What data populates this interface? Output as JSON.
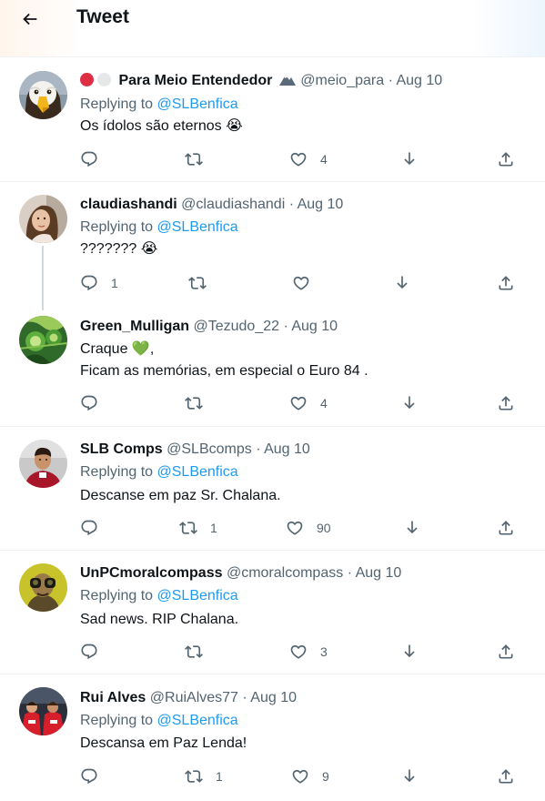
{
  "header": {
    "title": "Tweet",
    "back_icon": "arrow-left-icon"
  },
  "replying_label": "Replying to",
  "tweets": [
    {
      "name": "Para Meio Entendedor",
      "name_prefix_icons": [
        "red-circle-icon",
        "white-circle-icon"
      ],
      "name_suffix_icon": "mountain-icon",
      "handle": "@meio_para",
      "sep": "·",
      "date": "Aug 10",
      "replying_to": "@SLBenfica",
      "lines": [
        "Os ídolos são eternos 😭"
      ],
      "reply_count": "",
      "retweet_count": "",
      "like_count": "4",
      "avatar": "eagle-avatar"
    },
    {
      "name": "claudiashandi",
      "handle": "@claudiashandi",
      "sep": "·",
      "date": "Aug 10",
      "replying_to": "@SLBenfica",
      "lines": [
        "??????? 😭"
      ],
      "reply_count": "1",
      "retweet_count": "",
      "like_count": "",
      "avatar": "woman-photo-avatar"
    },
    {
      "name": "Green_Mulligan",
      "handle": "@Tezudo_22",
      "sep": "·",
      "date": "Aug 10",
      "replying_to": "",
      "lines": [
        "Craque 💚,",
        "Ficam as memórias, em especial o Euro 84 ."
      ],
      "reply_count": "",
      "retweet_count": "",
      "like_count": "4",
      "avatar": "green-pattern-avatar"
    },
    {
      "name": "SLB Comps",
      "handle": "@SLBcomps",
      "sep": "·",
      "date": "Aug 10",
      "replying_to": "@SLBenfica",
      "lines": [
        "Descanse em paz Sr. Chalana."
      ],
      "reply_count": "",
      "retweet_count": "1",
      "like_count": "90",
      "avatar": "player-photo-avatar"
    },
    {
      "name": "UnPCmoralcompass",
      "handle": "@cmoralcompass",
      "sep": "·",
      "date": "Aug 10",
      "replying_to": "@SLBenfica",
      "lines": [
        "Sad news. RIP Chalana."
      ],
      "reply_count": "",
      "retweet_count": "",
      "like_count": "3",
      "avatar": "binoculars-man-avatar"
    },
    {
      "name": "Rui Alves",
      "handle": "@RuiAlves77",
      "sep": "·",
      "date": "Aug 10",
      "replying_to": "@SLBenfica",
      "lines": [
        "Descansa em Paz Lenda!"
      ],
      "reply_count": "",
      "retweet_count": "1",
      "like_count": "9",
      "avatar": "football-team-avatar"
    }
  ],
  "colors": {
    "text": "#0f1419",
    "muted": "#536471",
    "link": "#1d9bf0",
    "divider": "#eff3f4",
    "thread_line": "#cfd9de"
  },
  "action_icons": [
    "reply-icon",
    "retweet-icon",
    "like-icon",
    "download-icon",
    "share-icon"
  ]
}
